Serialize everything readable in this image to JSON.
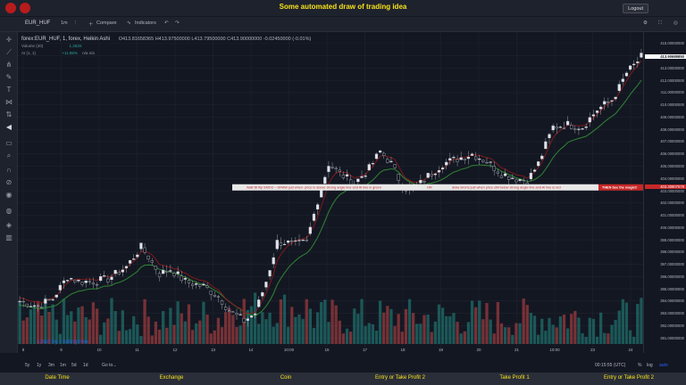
{
  "page": {
    "title": "Some automated draw of trading idea",
    "logout_label": "Logout"
  },
  "toolbar": {
    "symbol": "EUR_HUF",
    "interval": "1m",
    "compare_label": "Compare",
    "indicators_label": "Indicators"
  },
  "legend": {
    "symbol": "forex:EUR_HUF, 1, forex, Heikin Ashi",
    "ohlc": "O413.81658365  H413.97500000  L413.79500000  C413.90000000  -0.02450000 (-0.01%)",
    "volume_label": "Volume (20)",
    "volume_value": "1.262K",
    "ai_label": "AI (1, 1)",
    "ai_value": "+11.85%",
    "ai_na": "n/a  n/a"
  },
  "price_axis": {
    "labels": [
      "415.00000000",
      "414.00000000",
      "413.00000000",
      "412.00000000",
      "411.00000000",
      "410.00000000",
      "409.00000000",
      "408.00000000",
      "407.00000000",
      "406.00000000",
      "405.00000000",
      "404.00000000",
      "403.00000000",
      "402.00000000",
      "401.00000000",
      "400.00000000",
      "399.00000000",
      "398.00000000",
      "397.00000000",
      "396.00000000",
      "395.00000000",
      "394.00000000",
      "393.00000000",
      "392.00000000",
      "391.00000000"
    ],
    "current": "413.90689850",
    "line_value": "403.30907578"
  },
  "time_axis": {
    "labels": [
      "8",
      "9",
      "10",
      "11",
      "12",
      "13",
      "14",
      "10:00",
      "16",
      "17",
      "18",
      "19",
      "20",
      "21",
      "10:00",
      "23",
      "24"
    ]
  },
  "annotations": {
    "bar_text_1": "Wait till flip SMO3 -- DRAW just when: price is above strong angle line and AI line is green",
    "bar_text_2": "OR",
    "bar_text_3": "draw shorts just when price still below strong angle line and AI line is red",
    "bar_text_4": "THEN See the magic!!"
  },
  "watermark": "Chart by TradingView",
  "bottom": {
    "ranges": [
      "5y",
      "1y",
      "3m",
      "1m",
      "5d",
      "1d"
    ],
    "goto": "Go to...",
    "time": "00:15:55 (UTC)",
    "pct": "%",
    "log": "log",
    "auto": "auto"
  },
  "footer": {
    "items": [
      "Date Time",
      "Exchange",
      "Coin",
      "Entry or Take Profit 2",
      "Take Profit 1",
      "Entry or Take Profit 2"
    ]
  },
  "colors": {
    "accent": "#f7e21a",
    "up": "#26a69a",
    "down": "#ef5350",
    "strong_line": "#2e7d32",
    "band": "#c62828"
  },
  "chart_data": {
    "type": "candlestick",
    "title": "forex:EUR_HUF, 1, forex, Heikin Ashi",
    "ylim": [
      390.5,
      415.5
    ],
    "keypoints": [
      [
        0,
        394.0
      ],
      [
        5,
        393.6
      ],
      [
        9,
        394.2
      ],
      [
        13,
        396.0
      ],
      [
        16,
        395.6
      ],
      [
        20,
        395.6
      ],
      [
        24,
        395.8
      ],
      [
        29,
        396.8
      ],
      [
        33,
        398.4
      ],
      [
        35,
        397.6
      ],
      [
        38,
        396.2
      ],
      [
        41,
        396.6
      ],
      [
        45,
        395.6
      ],
      [
        50,
        395.2
      ],
      [
        54,
        394.4
      ],
      [
        57,
        393.2
      ],
      [
        61,
        392.4
      ],
      [
        64,
        393.0
      ],
      [
        67,
        395.6
      ],
      [
        70,
        398.8
      ],
      [
        72,
        398.8
      ],
      [
        75,
        398.6
      ],
      [
        78,
        398.8
      ],
      [
        81,
        402.2
      ],
      [
        84,
        405.2
      ],
      [
        87,
        404.4
      ],
      [
        91,
        403.6
      ],
      [
        95,
        404.8
      ],
      [
        98,
        406.2
      ],
      [
        101,
        405.2
      ],
      [
        104,
        403.4
      ],
      [
        107,
        403.0
      ],
      [
        111,
        404.2
      ],
      [
        115,
        405.2
      ],
      [
        119,
        405.6
      ],
      [
        123,
        406.0
      ],
      [
        127,
        405.4
      ],
      [
        131,
        404.4
      ],
      [
        135,
        404.0
      ],
      [
        138,
        403.8
      ],
      [
        141,
        405.2
      ],
      [
        145,
        408.2
      ],
      [
        149,
        408.4
      ],
      [
        153,
        408.2
      ],
      [
        157,
        409.6
      ],
      [
        161,
        410.4
      ],
      [
        163,
        411.4
      ],
      [
        165,
        412.6
      ],
      [
        167,
        413.2
      ],
      [
        169,
        413.9
      ]
    ],
    "n_bars": 170,
    "volume_range": [
      0,
      1.3
    ],
    "band_level": 403.309
  }
}
